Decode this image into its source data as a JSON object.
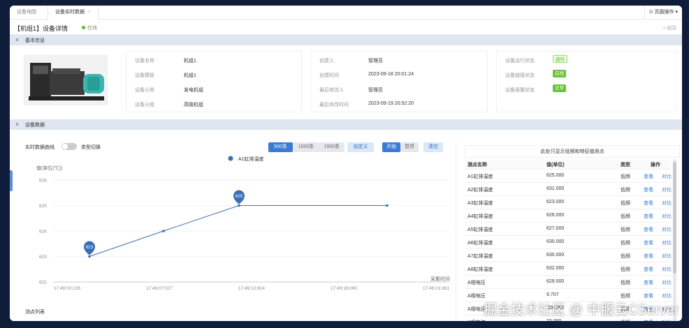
{
  "tabs": [
    {
      "label": "设备地图"
    },
    {
      "label": "设备实时数据",
      "close": "×"
    }
  ],
  "page_ops": "⊙ 页面操作 ▾",
  "header": {
    "title": "【机组1】设备详情",
    "status": "在线",
    "back": "⇢ 返回"
  },
  "basic_info": {
    "section_label": "基本信息",
    "panel1": [
      {
        "k": "设备名称",
        "v": "机组1"
      },
      {
        "k": "设备模板",
        "v": "机组1"
      },
      {
        "k": "设备分类",
        "v": "发电机组"
      },
      {
        "k": "设备分组",
        "v": "高陵机组"
      }
    ],
    "panel2": [
      {
        "k": "创建人",
        "v": "管理员"
      },
      {
        "k": "创建时间",
        "v": "2023-09-18 20:01:24"
      },
      {
        "k": "最后修改人",
        "v": "管理员"
      },
      {
        "k": "最后修改时间",
        "v": "2023-09-19 20:52:20"
      }
    ],
    "panel3": [
      {
        "k": "设备运行状态",
        "v": "运行"
      },
      {
        "k": "设备链接状态",
        "v": "在线"
      },
      {
        "k": "设备报警状态",
        "v": "正常"
      }
    ]
  },
  "device_data": {
    "section_label": "设备数据",
    "realtime_label": "实时数据曲线",
    "type_switch": "类型切换",
    "range_buttons": [
      "500条",
      "1000条",
      "1500条"
    ],
    "custom_button": "自定义",
    "start_button": "开始",
    "pause_button": "暂停",
    "clear_button": "清空",
    "bottom_label": "测点列表"
  },
  "chart_data": {
    "type": "line",
    "title": "",
    "ylabel": "值(单位(℃))",
    "xlabel": "采集时间",
    "legend": "A1缸排温度",
    "x": [
      "17:49:02:226",
      "17:49:07:527",
      "17:49:12:814",
      "17:49:18:090",
      "17:49:23:381"
    ],
    "points": [
      {
        "x": 0.0,
        "y": 623
      },
      {
        "x": 1.0,
        "y": 624
      },
      {
        "x": 2.0,
        "y": 625
      },
      {
        "x": 4.0,
        "y": 625
      }
    ],
    "ylim": [
      622,
      626
    ],
    "yticks": [
      622,
      623,
      624,
      625,
      626
    ],
    "markers": [
      {
        "x": 0.0,
        "y": 623,
        "label": "623"
      },
      {
        "x": 2.0,
        "y": 625,
        "label": "625"
      }
    ],
    "color": "#3a6fb5"
  },
  "table": {
    "note": "此处只显示低频和特征值测点",
    "headers": [
      "测点名称",
      "值(单位)",
      "类型",
      "操作"
    ],
    "view": "查看",
    "compare": "对比",
    "rows": [
      {
        "name": "A1缸排温度",
        "value": "625.000",
        "type": "低频"
      },
      {
        "name": "A2缸排温度",
        "value": "631.000",
        "type": "低频"
      },
      {
        "name": "A3缸排温度",
        "value": "623.000",
        "type": "低频"
      },
      {
        "name": "A4缸排温度",
        "value": "626.000",
        "type": "低频"
      },
      {
        "name": "A5缸排温度",
        "value": "627.000",
        "type": "低频"
      },
      {
        "name": "A6缸排温度",
        "value": "630.000",
        "type": "低频"
      },
      {
        "name": "A7缸排温度",
        "value": "630.000",
        "type": "低频"
      },
      {
        "name": "A8缸排温度",
        "value": "632.000",
        "type": "低频"
      },
      {
        "name": "A相电压",
        "value": "629.000",
        "type": "低频"
      },
      {
        "name": "A相电压",
        "value": "9.707",
        "type": "低频"
      },
      {
        "name": "A相电压",
        "value": "620.000",
        "type": "低频"
      },
      {
        "name": "A相电流",
        "value": "22.000",
        "type": "低频"
      }
    ]
  },
  "watermark": "掘金技术社区 @ 中服云CServer",
  "colors": {
    "accent": "#3a7bd5",
    "online": "#52c41a",
    "ok": "#67c23a"
  }
}
